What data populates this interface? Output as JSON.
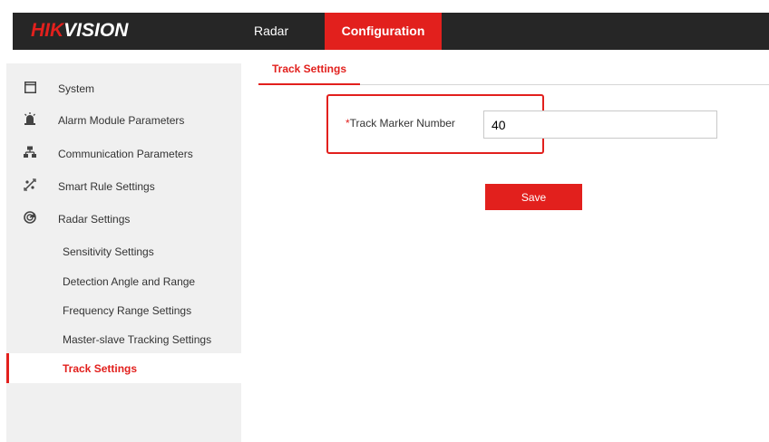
{
  "app": {
    "brand_red": "HIK",
    "brand_white": "VISION",
    "accent_color": "#e2201d"
  },
  "topnav": {
    "tabs": [
      {
        "label": "Radar",
        "active": false
      },
      {
        "label": "Configuration",
        "active": true
      }
    ]
  },
  "sidebar": {
    "items": [
      {
        "label": "System",
        "icon": "window-icon"
      },
      {
        "label": "Alarm Module Parameters",
        "icon": "alarm-light-icon"
      },
      {
        "label": "Communication Parameters",
        "icon": "network-icon"
      },
      {
        "label": "Smart Rule Settings",
        "icon": "smart-rule-icon"
      },
      {
        "label": "Radar Settings",
        "icon": "radar-icon"
      }
    ],
    "subitems": [
      {
        "label": "Sensitivity Settings",
        "active": false
      },
      {
        "label": "Detection Angle and Range",
        "active": false
      },
      {
        "label": "Frequency Range Settings",
        "active": false
      },
      {
        "label": "Master-slave Tracking Settings",
        "active": false
      },
      {
        "label": "Track Settings",
        "active": true
      }
    ]
  },
  "main": {
    "tab_label": "Track Settings",
    "field": {
      "required_mark": "*",
      "label": "Track Marker Number",
      "value": "40"
    },
    "save_label": "Save"
  }
}
